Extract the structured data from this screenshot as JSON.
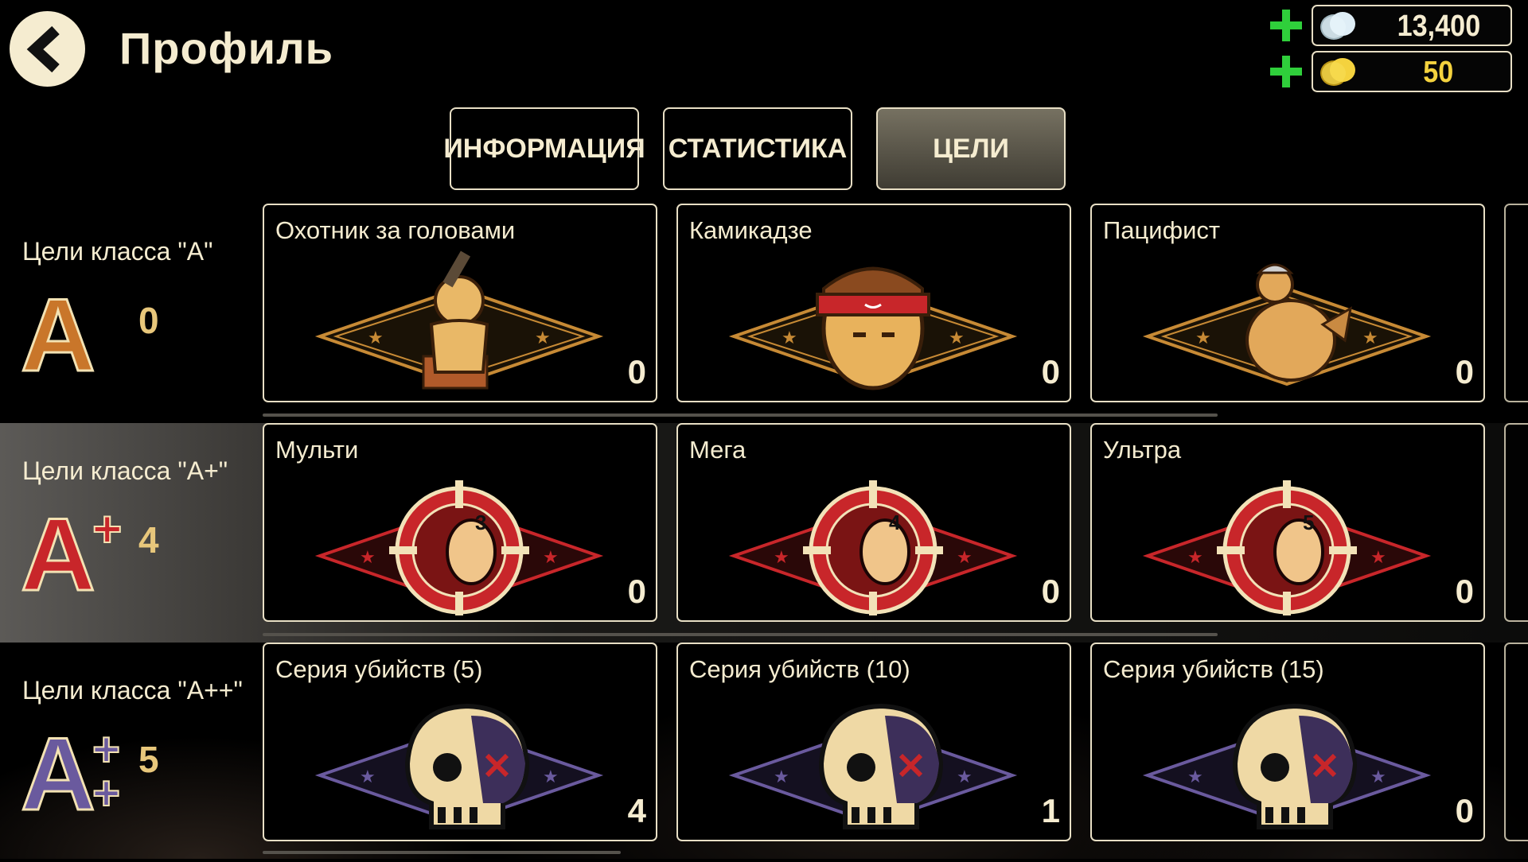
{
  "header": {
    "title": "Профиль",
    "currencies": [
      {
        "name": "silver",
        "value": "13,400",
        "color": "#dfeef6"
      },
      {
        "name": "gold",
        "value": "50",
        "color": "#f4d23e"
      }
    ]
  },
  "tabs": [
    {
      "label": "ИНФОРМАЦИЯ",
      "active": false
    },
    {
      "label": "СТАТИСТИКА",
      "active": false
    },
    {
      "label": "ЦЕЛИ",
      "active": true
    }
  ],
  "rows": [
    {
      "class_name": "Цели класса \"A\"",
      "count": "0",
      "color": "#c9762a",
      "goals": [
        {
          "title": "Охотник за головами",
          "value": "0",
          "icon": "bounty-hunter-icon"
        },
        {
          "title": "Камикадзе",
          "value": "0",
          "icon": "kamikaze-icon"
        },
        {
          "title": "Пацифист",
          "value": "0",
          "icon": "pacifist-chicken-icon"
        }
      ]
    },
    {
      "class_name": "Цели класса \"A+\"",
      "count": "4",
      "color": "#c8262a",
      "goals": [
        {
          "title": "Мульти",
          "value": "0",
          "icon": "multi-kill-3-icon"
        },
        {
          "title": "Мега",
          "value": "0",
          "icon": "multi-kill-4-icon"
        },
        {
          "title": "Ультра",
          "value": "0",
          "icon": "multi-kill-5-icon"
        }
      ]
    },
    {
      "class_name": "Цели класса \"A++\"",
      "count": "5",
      "color": "#6a5a9e",
      "goals": [
        {
          "title": "Серия убийств (5)",
          "value": "4",
          "icon": "skull-streak-icon"
        },
        {
          "title": "Серия убийств (10)",
          "value": "1",
          "icon": "skull-streak-icon"
        },
        {
          "title": "Серия убийств (15)",
          "value": "0",
          "icon": "skull-streak-icon"
        }
      ]
    }
  ]
}
